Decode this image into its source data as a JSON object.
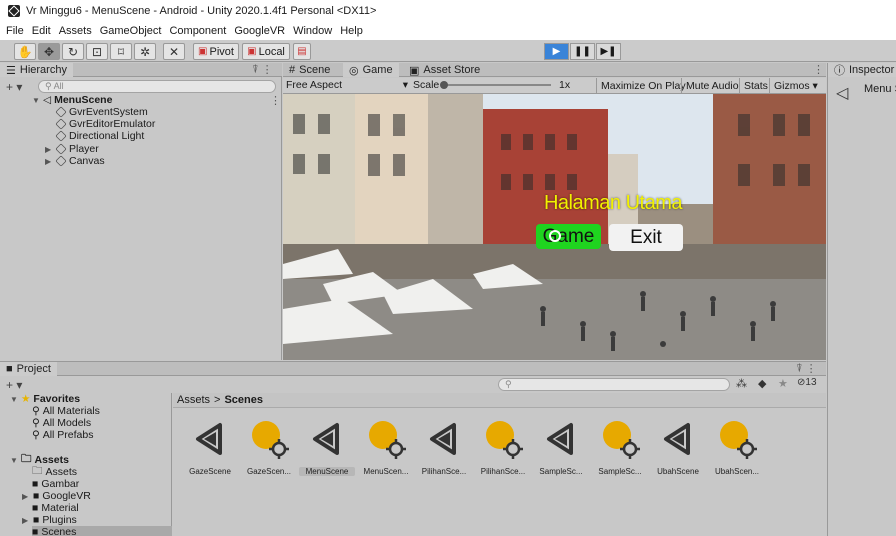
{
  "window": {
    "title": "Vr Minggu6 - MenuScene - Android - Unity 2020.1.4f1 Personal <DX11>"
  },
  "menu": [
    "File",
    "Edit",
    "Assets",
    "GameObject",
    "Component",
    "GoogleVR",
    "Window",
    "Help"
  ],
  "toolbar": {
    "pivot_label": "Pivot",
    "local_label": "Local"
  },
  "hierarchy": {
    "tab": "Hierarchy",
    "search_placeholder": "All",
    "scene": "MenuScene",
    "items": [
      "GvrEventSystem",
      "GvrEditorEmulator",
      "Directional Light",
      "Player",
      "Canvas"
    ]
  },
  "scene_tabs": {
    "scene": "Scene",
    "game": "Game",
    "asset_store": "Asset Store"
  },
  "game_toolbar": {
    "aspect": "Free Aspect",
    "scale_label": "Scale",
    "scale_value": "1x",
    "maximize": "Maximize On Play",
    "mute": "Mute Audio",
    "stats": "Stats",
    "gizmos": "Gizmos"
  },
  "game_view": {
    "heading": "Halaman Utama",
    "game_button": "Game",
    "exit_button": "Exit",
    "colors": {
      "heading": "#f2f200",
      "game_button": "#1fd41f",
      "exit_button": "#f2f2f2"
    }
  },
  "inspector": {
    "tab": "Inspector",
    "object": "Menu S"
  },
  "project": {
    "tab": "Project",
    "count": "13",
    "favorites_label": "Favorites",
    "favorites": [
      "All Materials",
      "All Models",
      "All Prefabs"
    ],
    "assets_label": "Assets",
    "folders": [
      "Assets",
      "Gambar",
      "GoogleVR",
      "Material",
      "Plugins",
      "Scenes"
    ],
    "breadcrumb_root": "Assets",
    "breadcrumb_sep": ">",
    "breadcrumb_current": "Scenes",
    "files": [
      {
        "label": "GazeScene",
        "kind": "scene"
      },
      {
        "label": "GazeScen...",
        "kind": "settings"
      },
      {
        "label": "MenuScene",
        "kind": "scene",
        "selected": true
      },
      {
        "label": "MenuScen...",
        "kind": "settings"
      },
      {
        "label": "PilihanSce...",
        "kind": "scene"
      },
      {
        "label": "PilihanSce...",
        "kind": "settings"
      },
      {
        "label": "SampleSc...",
        "kind": "scene"
      },
      {
        "label": "SampleSc...",
        "kind": "settings"
      },
      {
        "label": "UbahScene",
        "kind": "scene"
      },
      {
        "label": "UbahScen...",
        "kind": "settings"
      }
    ]
  },
  "icons": {
    "hand": "hand-icon",
    "move": "move-icon",
    "rotate": "rotate-icon",
    "scale": "scale-icon",
    "rect": "rect-tool-icon",
    "transform": "transform-icon",
    "custom": "custom-tool-icon",
    "play": "play-icon",
    "pause": "pause-icon",
    "step": "step-icon"
  }
}
